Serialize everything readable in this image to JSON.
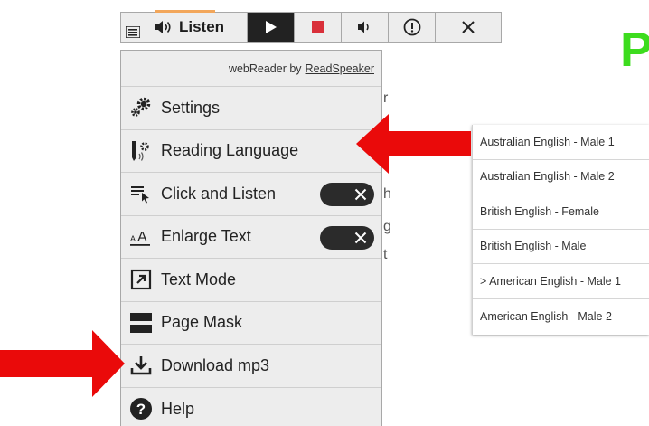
{
  "toolbar": {
    "listen_label": "Listen",
    "buttons": [
      "menu-icon",
      "speaker-icon",
      "play-icon",
      "stop-icon",
      "volume-icon",
      "info-icon",
      "close-icon"
    ]
  },
  "menu": {
    "credit_prefix": "webReader by",
    "credit_link": "ReadSpeaker",
    "items": [
      {
        "label": "Settings",
        "icon": "settings-gears-icon"
      },
      {
        "label": "Reading Language",
        "icon": "reading-language-icon"
      },
      {
        "label": "Click and Listen",
        "icon": "click-listen-icon",
        "toggle": "off"
      },
      {
        "label": "Enlarge Text",
        "icon": "enlarge-text-icon",
        "toggle": "off"
      },
      {
        "label": "Text Mode",
        "icon": "text-mode-icon"
      },
      {
        "label": "Page Mask",
        "icon": "page-mask-icon"
      },
      {
        "label": "Download mp3",
        "icon": "download-icon"
      },
      {
        "label": "Help",
        "icon": "help-icon"
      }
    ]
  },
  "languages": {
    "items": [
      "Australian English - Male 1",
      "Australian English - Male 2",
      "British English - Female",
      "British English - Male",
      "> American English - Male 1",
      "American English - Male 2"
    ]
  },
  "colors": {
    "arrow": "#ea0a0a",
    "toolbar_bg": "#ededed",
    "stop": "#d9303a",
    "green_fragment": "#3ddc1e",
    "toggle": "#2b2b2b"
  }
}
